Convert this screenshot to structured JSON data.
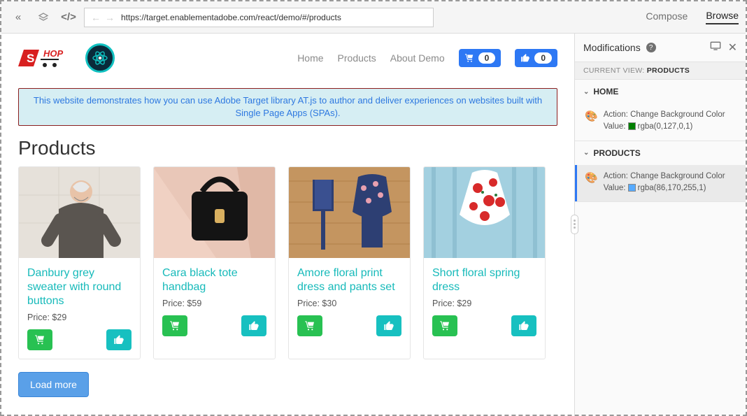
{
  "toolbar": {
    "url": "https://target.enablementadobe.com/react/demo/#/products",
    "modes": {
      "compose": "Compose",
      "browse": "Browse"
    }
  },
  "site": {
    "nav": {
      "home": "Home",
      "products": "Products",
      "about": "About Demo"
    },
    "cart_count": "0",
    "like_count": "0",
    "banner": "This website demonstrates how you can use Adobe Target library AT.js to author and deliver experiences on websites built with Single Page Apps (SPAs).",
    "section_title": "Products",
    "products": [
      {
        "title": "Danbury grey sweater with round buttons",
        "price": "Price: $29"
      },
      {
        "title": "Cara black tote handbag",
        "price": "Price: $59"
      },
      {
        "title": "Amore floral print dress and pants set",
        "price": "Price: $30"
      },
      {
        "title": "Short floral spring dress",
        "price": "Price: $29"
      }
    ],
    "load_more": "Load more"
  },
  "panel": {
    "title": "Modifications",
    "current_view_label": "CURRENT VIEW:",
    "current_view_value": "PRODUCTS",
    "views": [
      {
        "name": "HOME",
        "active": false,
        "mod": {
          "action_label": "Action:",
          "action_value": "Change Background Color",
          "value_label": "Value:",
          "color": "rgba(0,127,0,1)",
          "swatch": "#007f00"
        }
      },
      {
        "name": "PRODUCTS",
        "active": true,
        "mod": {
          "action_label": "Action:",
          "action_value": "Change Background Color",
          "value_label": "Value:",
          "color": "rgba(86,170,255,1)",
          "swatch": "#56aaff"
        }
      }
    ]
  }
}
